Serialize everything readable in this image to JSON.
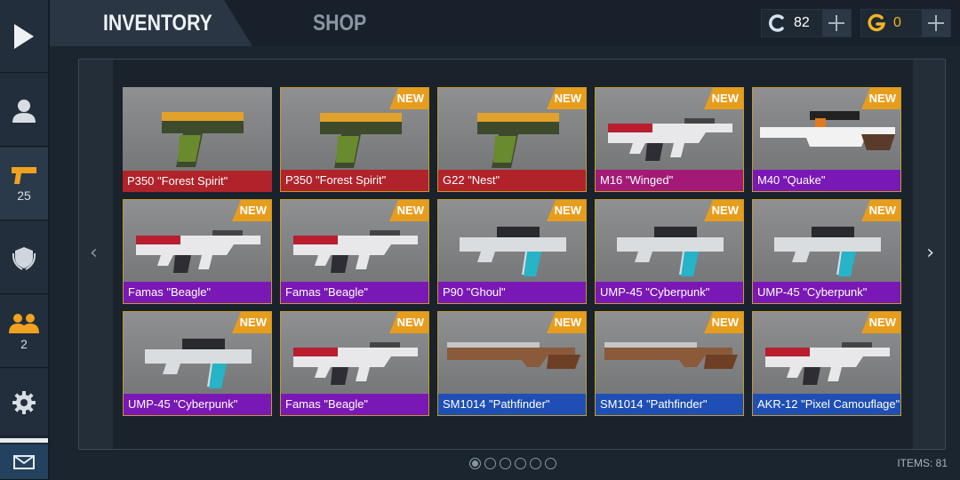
{
  "tabs": {
    "inventory": "INVENTORY",
    "shop": "SHOP"
  },
  "currency": {
    "credits": {
      "icon": "credits-c-icon",
      "value": "82",
      "color": "#d6e2ee"
    },
    "gold": {
      "icon": "gold-g-icon",
      "value": "0",
      "color": "#f0b323"
    }
  },
  "sidebar": {
    "weapons_count": "25",
    "friends_count": "2"
  },
  "rarity_colors": {
    "red": "#b0232a",
    "purple": "#7a18b5",
    "magenta": "#a21a76",
    "blue": "#1f4fb4",
    "new_badge": "#e79d1c"
  },
  "items": [
    {
      "name": "P350 \"Forest Spirit\"",
      "rarity": "red",
      "is_new": false,
      "icon": "pistol-icon"
    },
    {
      "name": "P350 \"Forest Spirit\"",
      "rarity": "red",
      "is_new": true,
      "icon": "pistol-icon"
    },
    {
      "name": "G22 \"Nest\"",
      "rarity": "red",
      "is_new": true,
      "icon": "pistol-icon"
    },
    {
      "name": "M16 \"Winged\"",
      "rarity": "magenta",
      "is_new": true,
      "icon": "rifle-icon"
    },
    {
      "name": "M40 \"Quake\"",
      "rarity": "purple",
      "is_new": true,
      "icon": "sniper-icon"
    },
    {
      "name": "Famas \"Beagle\"",
      "rarity": "purple",
      "is_new": true,
      "icon": "rifle-icon"
    },
    {
      "name": "Famas \"Beagle\"",
      "rarity": "purple",
      "is_new": true,
      "icon": "rifle-icon"
    },
    {
      "name": "P90 \"Ghoul\"",
      "rarity": "purple",
      "is_new": true,
      "icon": "smg-icon"
    },
    {
      "name": "UMP-45 \"Cyberpunk\"",
      "rarity": "purple",
      "is_new": true,
      "icon": "smg-icon"
    },
    {
      "name": "UMP-45 \"Cyberpunk\"",
      "rarity": "purple",
      "is_new": true,
      "icon": "smg-icon"
    },
    {
      "name": "UMP-45 \"Cyberpunk\"",
      "rarity": "purple",
      "is_new": true,
      "icon": "smg-icon"
    },
    {
      "name": "Famas \"Beagle\"",
      "rarity": "purple",
      "is_new": true,
      "icon": "rifle-icon"
    },
    {
      "name": "SM1014 \"Pathfinder\"",
      "rarity": "blue",
      "is_new": true,
      "icon": "shotgun-icon"
    },
    {
      "name": "SM1014 \"Pathfinder\"",
      "rarity": "blue",
      "is_new": true,
      "icon": "shotgun-icon"
    },
    {
      "name": "AKR-12 \"Pixel Camouflage\"",
      "rarity": "blue",
      "is_new": true,
      "icon": "rifle-icon"
    }
  ],
  "new_label": "NEW",
  "pager": {
    "pages": 6,
    "current": 1
  },
  "items_count": "ITEMS: 81"
}
